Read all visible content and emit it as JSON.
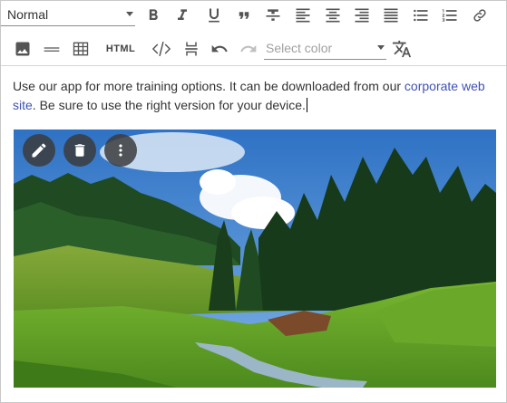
{
  "toolbar": {
    "block_format": {
      "selected": "Normal"
    },
    "html_label": "HTML",
    "color_select": {
      "placeholder": "Select color"
    },
    "icons": [
      "bold-icon",
      "italic-icon",
      "underline-icon",
      "blockquote-icon",
      "strikethrough-icon",
      "align-left-icon",
      "align-center-icon",
      "align-right-icon",
      "align-justify-icon",
      "bulleted-list-icon",
      "numbered-list-icon",
      "link-icon",
      "image-icon",
      "horizontal-rule-icon",
      "table-icon",
      "html-source-icon",
      "code-icon",
      "page-break-icon",
      "undo-icon",
      "redo-icon",
      "translate-icon"
    ],
    "redo_enabled": false
  },
  "content": {
    "text_before": "Use our app for more training options. It can be downloaded from our ",
    "link_text": "corporate web site",
    "text_after": ". Be sure to use the right version for your device."
  },
  "image": {
    "actions": [
      "edit-icon",
      "delete-icon",
      "more-vert-icon"
    ]
  },
  "colors": {
    "link": "#3f51b5",
    "icon": "#555555",
    "disabled_icon": "#c0c0c0",
    "action_bg": "#3c3c3c"
  }
}
